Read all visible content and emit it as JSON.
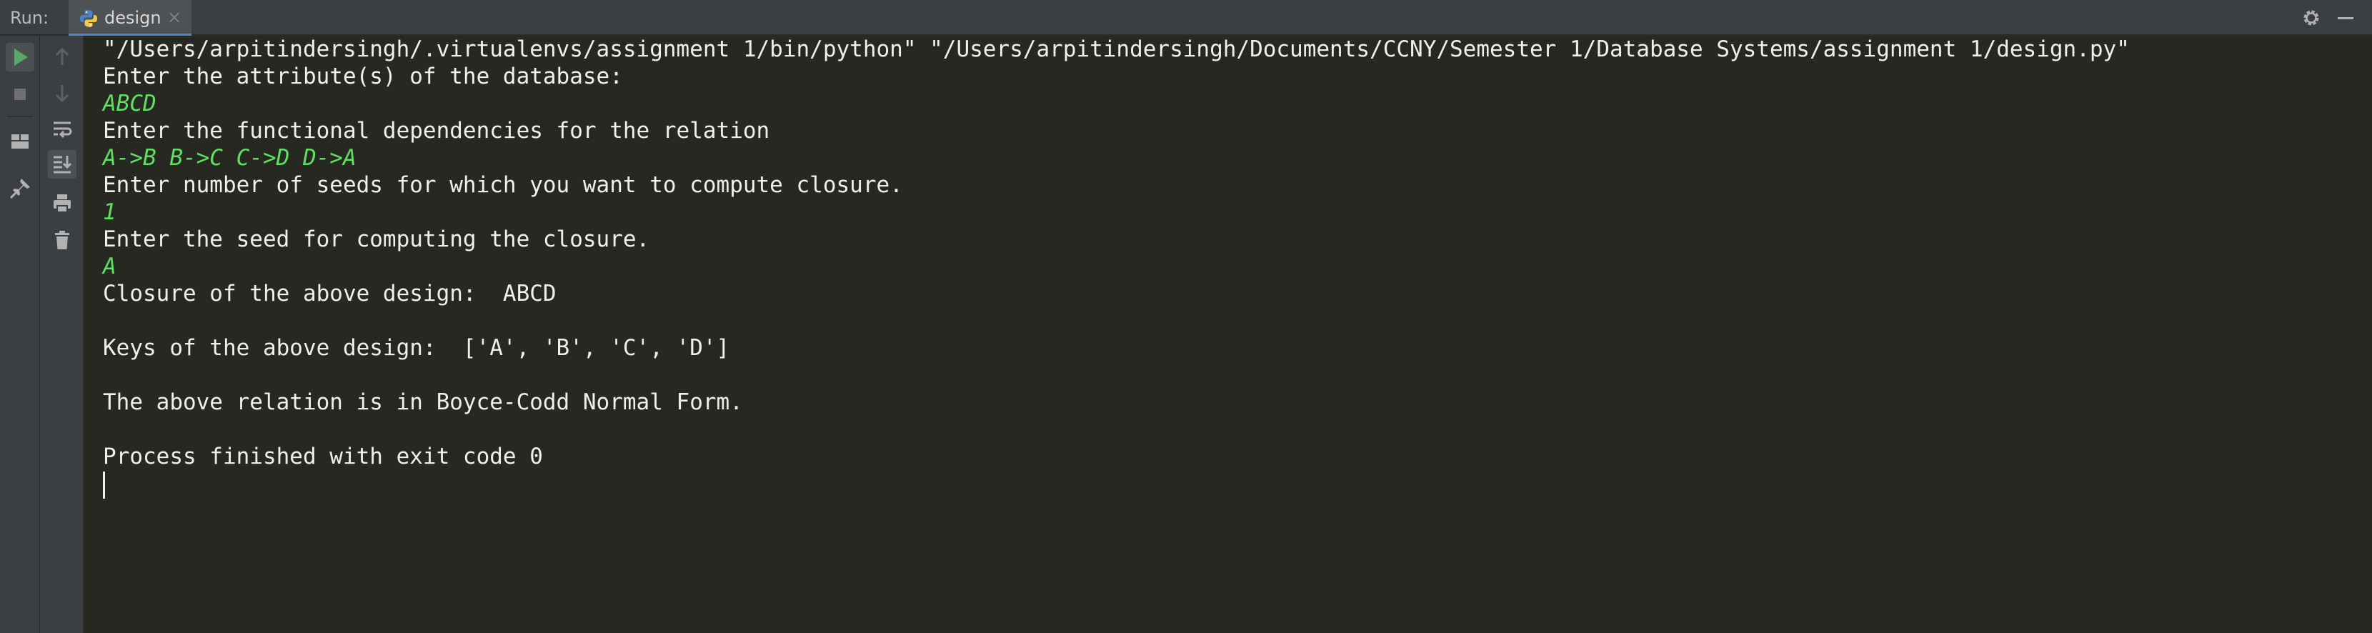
{
  "header": {
    "run_label": "Run:",
    "tab": {
      "label": "design",
      "icon": "python-icon"
    },
    "settings_icon": "gear-icon",
    "hide_icon": "minimize-icon"
  },
  "toolbar": {
    "left": [
      {
        "name": "rerun-button",
        "icon": "play-icon"
      },
      {
        "name": "stop-button",
        "icon": "stop-icon"
      },
      {
        "name": "restore-layout-button",
        "icon": "layout-icon"
      },
      {
        "name": "pin-tab-button",
        "icon": "pin-icon"
      }
    ],
    "right": [
      {
        "name": "scroll-up-button",
        "icon": "arrow-up-icon"
      },
      {
        "name": "scroll-down-button",
        "icon": "arrow-down-icon"
      },
      {
        "name": "soft-wrap-button",
        "icon": "wrap-icon"
      },
      {
        "name": "scroll-to-end-button",
        "icon": "scroll-end-icon"
      },
      {
        "name": "print-button",
        "icon": "print-icon"
      },
      {
        "name": "clear-all-button",
        "icon": "trash-icon"
      }
    ]
  },
  "console": {
    "lines": [
      {
        "text": "\"/Users/arpitindersingh/.virtualenvs/assignment 1/bin/python\" \"/Users/arpitindersingh/Documents/CCNY/Semester 1/Database Systems/assignment 1/design.py\"",
        "kind": "output"
      },
      {
        "text": "Enter the attribute(s) of the database:",
        "kind": "output"
      },
      {
        "text": "ABCD",
        "kind": "input"
      },
      {
        "text": "Enter the functional dependencies for the relation",
        "kind": "output"
      },
      {
        "text": "A->B B->C C->D D->A",
        "kind": "input"
      },
      {
        "text": "Enter number of seeds for which you want to compute closure.",
        "kind": "output"
      },
      {
        "text": "1",
        "kind": "input"
      },
      {
        "text": "Enter the seed for computing the closure.",
        "kind": "output"
      },
      {
        "text": "A",
        "kind": "input"
      },
      {
        "text": "Closure of the above design:  ABCD",
        "kind": "output"
      },
      {
        "text": "",
        "kind": "output"
      },
      {
        "text": "Keys of the above design:  ['A', 'B', 'C', 'D']",
        "kind": "output"
      },
      {
        "text": "",
        "kind": "output"
      },
      {
        "text": "The above relation is in Boyce-Codd Normal Form.",
        "kind": "output"
      },
      {
        "text": "",
        "kind": "output"
      },
      {
        "text": "Process finished with exit code 0",
        "kind": "output"
      }
    ]
  },
  "colors": {
    "background": "#272822",
    "output_text": "#f0f0ea",
    "input_text": "#5ee061",
    "toolbar": "#3c3f41",
    "run_green": "#59a869"
  }
}
